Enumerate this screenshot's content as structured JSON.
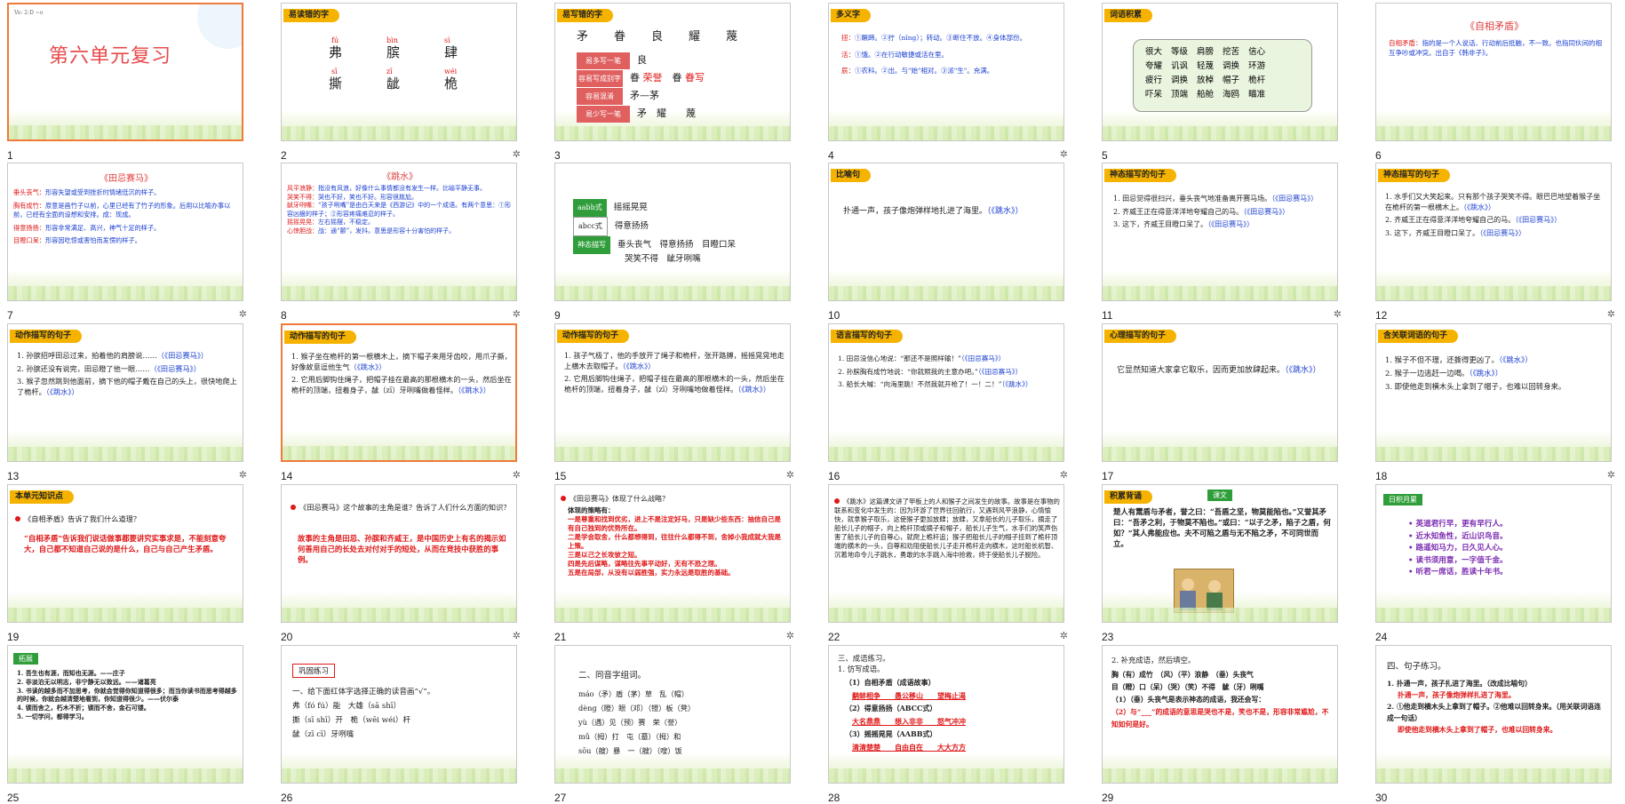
{
  "slides": [
    {
      "num": "1",
      "title": "第六单元复习",
      "header": "Ve: 2:D ~o"
    },
    {
      "num": "2",
      "tag": "易读错的字",
      "chars": [
        {
          "py": "fú",
          "ch": "弗"
        },
        {
          "py": "bìn",
          "ch": "膑"
        },
        {
          "py": "sì",
          "ch": "肆"
        },
        {
          "py": "sī",
          "ch": "撕"
        },
        {
          "py": "zī",
          "ch": "龇"
        },
        {
          "py": "wéi",
          "ch": "桅"
        }
      ]
    },
    {
      "num": "3",
      "tag": "易写错的字",
      "row1": "矛　　眷　　良　　耀　　蔑",
      "labels": [
        "易多写一笔",
        "容易写成别字",
        "容易混淆",
        "易少写一笔"
      ],
      "r1": "良",
      "r2a": "眷",
      "r2b": "荣誉",
      "r2c": "眷",
      "r2d": "眷写",
      "r3": "矛—茅",
      "r4": "矛　耀　　蔑"
    },
    {
      "num": "4",
      "tag": "多义字",
      "l1a": "扭：",
      "l1b": "①蹶蹄。②拧（nǐng）；转动。③断住不放。④身体部份。",
      "l2a": "活：",
      "l2b": "①饿。②在行动敏捷或活在里。",
      "l3a": "辰：",
      "l3b": "①农科。②出。与\"始\"相对。③派\"生\"。充满。"
    },
    {
      "num": "5",
      "tag": "词语积累",
      "words": [
        "很大",
        "等级",
        "肩膀",
        "挖苦",
        "信心",
        "夸耀",
        "讥讽",
        "轻蔑",
        "调换",
        "环游",
        "疲行",
        "调换",
        "放棹",
        "帽子",
        "桅杆",
        "吓呆",
        "顶端",
        "船舱",
        "海鸥",
        "瞄准"
      ]
    },
    {
      "num": "6",
      "heading": "《自相矛盾》",
      "body1": "自相矛盾：",
      "body2": "指的是一个人说话、行动前后抵触，不一致。也指同伙间的相互争吵或冲突。出自于《韩非子》。"
    },
    {
      "num": "7",
      "heading": "《田忌赛马》",
      "lines": [
        [
          "垂头丧气：",
          "形容失望或受到挫折时情绪低沉的样子。"
        ],
        [
          "胸有成竹：",
          "原意是画竹子以前，心里已经有了竹子的形象。后用以比喻办事以前，已经有全面的设想和安排。成：现成。"
        ],
        [
          "得意扬扬：",
          "形容非常满足、高兴，神气十足的样子。"
        ],
        [
          "目瞪口呆：",
          "形容因吃惊或害怕而发愣的样子。"
        ]
      ]
    },
    {
      "num": "8",
      "heading": "《跳水》",
      "lines": [
        [
          "风平浪静：",
          "指没有风浪，好像什么事情都没有发生一样。比喻平静无事。"
        ],
        [
          "哭笑不得：",
          "哭也不好，笑也不好。形容很尴尬。"
        ],
        [
          "龇牙咧嘴：",
          "“孩子咧嘴”是由白天来是《西游记》中的一个成语。有两个意思：①形容凶狠的样子；②形容疼痛难忍的样子。"
        ],
        [
          "摇摇晃晃：",
          "左右摇摆，不稳定。"
        ],
        [
          "心惊胆战：",
          "战：通“颤”，发抖。意思是形容十分害怕的样子。"
        ]
      ]
    },
    {
      "num": "9",
      "rows": [
        [
          "aabb式",
          "摇摇晃晃"
        ],
        [
          "abcc式",
          "得意扬扬"
        ],
        [
          "神态描写",
          "垂头丧气　得意扬扬　目瞪口呆"
        ]
      ],
      "extra": "哭笑不得　龇牙咧嘴"
    },
    {
      "num": "10",
      "tag": "比喻句",
      "line": "扑通一声，孩子像炮弹样地扎进了海里。",
      "src": "（《跳水》）"
    },
    {
      "num": "11",
      "tag": "神态描写的句子",
      "items": [
        "1. 田忌觉得很扫兴，垂头丧气地准备离开赛马场。",
        "2. 齐威王正在得意洋洋地夸耀自己的马。",
        "3. 这下，齐威王目瞪口呆了。"
      ],
      "src": "（《田忌赛马》）"
    },
    {
      "num": "12",
      "tag": "神态描写的句子",
      "items": [
        "1. 水手们又大笑起来。只有那个孩子哭笑不得。眼巴巴地望着猴子坐在桅杆的第一根横木上。",
        "2. 齐威王正在得意洋洋地夸耀自己的马。",
        "3. 这下，齐威王目瞪口呆了。"
      ],
      "src1": "（《跳水》）",
      "src2": "（《田忌赛马》）"
    },
    {
      "num": "13",
      "tag": "动作描写的句子",
      "items": [
        "1. 孙膑招呼田忌过来，拍着他的肩膀说……",
        "2. 孙膑还没有说完，田忌瞪了他一眼……",
        "3. 猴子忽然跳到他面前，摘下他的帽子戴在自己的头上，很快地爬上了桅杆。"
      ],
      "src1": "（《田忌赛马》）",
      "src2": "（《跳水》）"
    },
    {
      "num": "14",
      "tag": "动作描写的句子",
      "items": [
        "1. 猴子坐在桅杆的第一根横木上，摘下帽子来用牙齿咬，用爪子撕，好像故意逗他生气",
        "2. 它用后脚钩住绳子，把帽子挂在最高的那根横木的一头，然后坐在桅杆的顶端，扭着身子，龇（zī）牙咧嘴做着怪样。"
      ],
      "src": "（《跳水》）"
    },
    {
      "num": "15",
      "tag": "动作描写的句子",
      "items": [
        "1. 孩子气极了，他的手放开了绳子和桅杆，张开路膊，摇摇晃晃地走上横木去取帽子。",
        "2. 它用后脚钩住绳子，把帽子挂在最高的那根横木的一头，然后坐在桅杆的顶端，扭着身子，龇（zī）牙咧嘴地做着怪样。"
      ],
      "src": "（《跳水》）"
    },
    {
      "num": "16",
      "tag": "语言描写的句子",
      "items": [
        "1. 田忌没信心地说：“那还不是照样输！”",
        "2. 孙膑胸有成竹地说：“你就照我的主意办吧。”",
        "3. 船长大喊：“向海里跳！不然我就开枪了！一！二！”"
      ],
      "src1": "（《田忌赛马》）",
      "src2": "（《跳水》）"
    },
    {
      "num": "17",
      "tag": "心理描写的句子",
      "line": "它显然知道大家拿它取乐，因而更加放肆起来。",
      "src": "（《跳水》）"
    },
    {
      "num": "18",
      "tag": "含关联词语的句子",
      "items": [
        "1. 猴子不但不理，还撕得更凶了。",
        "2. 猴子一边逃赶一边喝。",
        "3. 即使他走到横木头上拿到了帽子，也难以回转身来。"
      ],
      "src": "（《跳水》）"
    },
    {
      "num": "19",
      "tag": "本单元知识点",
      "q": "《自相矛盾》告诉了我们什么道理？",
      "a": "“自相矛盾”告诉我们说话做事都要讲究实事求是，不能刻意夸大，自己都不知道自己说的是什么，自己与自己产生矛盾。"
    },
    {
      "num": "20",
      "q": "《田忌赛马》这个故事的主角是谁？告诉了人们什么方面的知识？",
      "a": "故事的主角是田忌、孙膑和齐威王，是中国历史上有名的揭示如何善用自己的长处去对付对手的短处，从而在竞技中获胜的事例。"
    },
    {
      "num": "21",
      "q": "《田忌赛马》体现了什么战略？",
      "head": "体现的策略有：",
      "items": [
        "一是尊重和找到优劣，进上不是注定好马，只是缺少些东西：抽信自己是有自己独到的优势所在。",
        "二是学会取舍，什么都想得到，往往什么都得不到，舍掉小我成就大我是上策。",
        "三是以己之长攻彼之短。",
        "四是先后谋略，谋略往先事平动好，无有不恐之理。",
        "五是在局部，从没有以弱胜强，实力永远是取胜的基础。"
      ]
    },
    {
      "num": "22",
      "text": "《跳水》这篇课文讲了甲板上的人和猴子之间发生的故事。故事是在事物的联系和变化中发生的：因为环游了世界往回航行，又遇到风平浪静，心情愉快，就拿猴子取乐，这使猴子更加放肆；放肆，又拿船长的儿子取乐，摘走了船长儿子的帽子，向上桅杆顶或摘子和帽子，船长儿子生气，水手们的笑声伤害了船长儿子的自尊心，就爬上桅杆追；猴子把船长儿子的帽子挂到了桅杆顶端的横木的一头，自尊和劝阻使船长儿子走开桅杆走向横木，这时船长机智、沉着地命令儿子跳水，勇敢的水手跳入海中抢救，终于使船长儿子脱险。"
    },
    {
      "num": "23",
      "tag": "积累背诵",
      "badge": "课文",
      "text": "楚人有鬻盾与矛者，誉之曰：“吾盾之坚，物莫能陷也。”又誉其矛曰：“吾矛之利，于物莫不陷也。”或曰：“以子之矛，陷子之盾，何如？”其人弗能应也。夫不可陷之盾与无不陷之矛，不可同世而立。"
    },
    {
      "num": "24",
      "badge": "日积月累",
      "items": [
        "英道君行早，更有早行人。",
        "近水知鱼性，近山识鸟音。",
        "路遥知马力，日久见人心。",
        "读书须用意，一字值千金。",
        "听君一席话，胜读十年书。"
      ]
    },
    {
      "num": "25",
      "badge": "拓展",
      "items": [
        "1. 吾生也有涯，而知也无涯。——庄子",
        "2. 非淡泊无以明志，非宁静无以致远。——诸葛亮",
        "3. 书读的越多而不加思考，你就会觉得你知道得很多；而当你读书而思考得越多的时候，你就会越清楚地看到，你知道得很少。——伏尔泰",
        "4. 锲而舍之，朽木不折；锲而不舍，金石可镂。",
        "5. 一切学问，都得学习。"
      ]
    },
    {
      "num": "26",
      "badge": "巩固练习",
      "q": "一、给下面红体字选择正确的读音画“√”。",
      "l1": "弗（fó fú）能　大雄（sā shī）",
      "l2": "撕（sī shī）开　桅（wēi wéi）杆",
      "l3": "龇（zī cī）牙咧嘴"
    },
    {
      "num": "27",
      "title": "二、同音字组词。",
      "rows": [
        "máo（矛）盾（茅）草　乱（帽）",
        "dèng（瞪）眼（邓）（镫）板（凳）",
        "yù（遇）见（预）赛　荣（誉）",
        "mǔ（拇）打　屯（墓）（拇）和",
        "sōu（艘）暴　一（艘）（嗖）饭"
      ]
    },
    {
      "num": "28",
      "title": "三、成语练习。",
      "sub": "1. 仿写成语。",
      "items": [
        "（1）自相矛盾（成语故事）",
        "鹬蚌相争　　愚公移山　　望梅止渴",
        "（2）得意扬扬（ABCC式）",
        "大名鼎鼎　　想入非非　　怒气冲冲",
        "（3）摇摇晃晃（AABB式）",
        "清清楚楚　　自由自在　　大大方方"
      ]
    },
    {
      "num": "29",
      "title": "2. 补充成语，然后填空。",
      "items": [
        "胸（有）成竹　（风）（平）浪静　（垂）头丧气",
        "目（瞪）口（呆）（哭）（笑）不得　龇（牙）咧嘴",
        "（1）（垂）头丧气是表示神态的成语，我还会写：",
        "（2）与“___”的成语的意思是哭也不是，笑也不是，形容非常尴尬，不知如何是好。"
      ]
    },
    {
      "num": "30",
      "title": "四、句子练习。",
      "items": [
        "1. 扑通一声，孩子扎进了海里。（改成比喻句）",
        "扑通一声，孩子像炮弹样扎进了海里。",
        "2. ①他走到横木头上拿到了帽子。②他难以回转身来。（用关联词语连成一句话）",
        "即使他走到横木头上拿到了帽子，也难以回转身来。"
      ]
    }
  ],
  "colors": {
    "tag": "#f5b300",
    "blue": "#1a3fd0",
    "red": "#e01818",
    "selected": "#f07a3a"
  }
}
